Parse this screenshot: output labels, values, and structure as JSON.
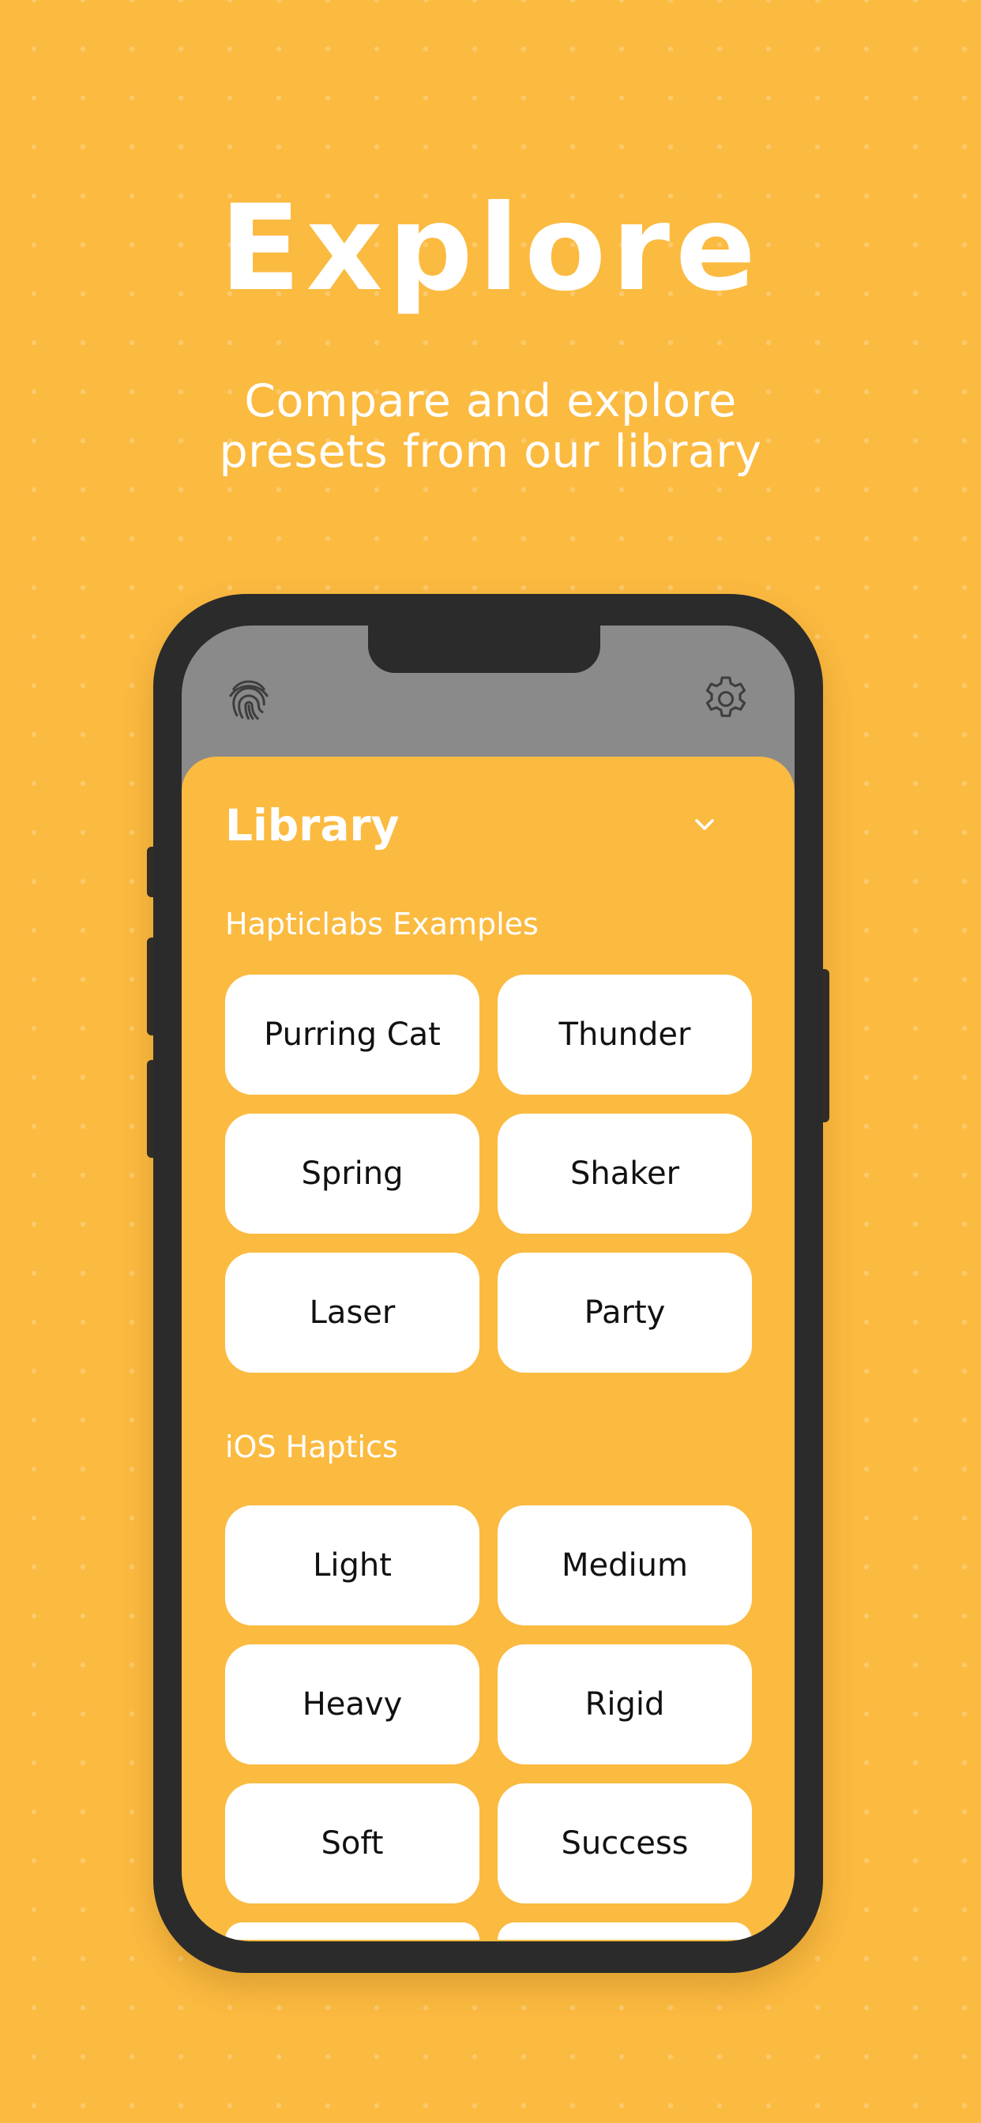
{
  "hero": {
    "title": "Explore",
    "subtitle_line1": "Compare and explore",
    "subtitle_line2": "presets from our library"
  },
  "phone": {
    "status_icons": [
      "fingerprint-icon",
      "gear-icon"
    ],
    "library": {
      "title": "Library",
      "toggle_icon": "chevron-down-icon",
      "sections": [
        {
          "label": "Hapticlabs Examples",
          "presets": [
            "Purring Cat",
            "Thunder",
            "Spring",
            "Shaker",
            "Laser",
            "Party"
          ]
        },
        {
          "label": "iOS Haptics",
          "presets": [
            "Light",
            "Medium",
            "Heavy",
            "Rigid",
            "Soft",
            "Success"
          ]
        }
      ]
    }
  },
  "colors": {
    "background": "#FBBA40",
    "phone_frame": "#2b2b2b",
    "status_area": "#8a8a8a",
    "button": "#FFFFFF",
    "button_text": "#111111",
    "text_light": "#FFFFFF"
  }
}
